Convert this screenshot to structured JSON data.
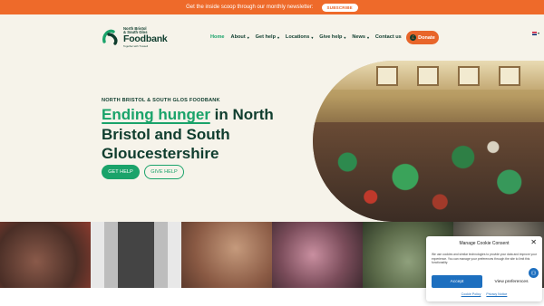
{
  "topbar": {
    "text": "Get the inside scoop through our monthly newsletter:",
    "button": "SUBSCRIBE"
  },
  "logo": {
    "line1": "North Bristol",
    "line2": "& South Glos",
    "name": "Foodbank",
    "tagline": "Together with Trussell"
  },
  "nav": {
    "items": [
      {
        "label": "Home",
        "active": true,
        "dropdown": false
      },
      {
        "label": "About",
        "dropdown": true
      },
      {
        "label": "Get help",
        "dropdown": true
      },
      {
        "label": "Locations",
        "dropdown": true
      },
      {
        "label": "Give help",
        "dropdown": true
      },
      {
        "label": "News",
        "dropdown": true
      },
      {
        "label": "Contact us",
        "dropdown": false
      }
    ],
    "donate": "Donate",
    "caret_glyph": "▾",
    "donate_icon_glyph": "£"
  },
  "hero": {
    "eyebrow": "NORTH BRISTOL & SOUTH GLOS FOODBANK",
    "headline_highlight": "Ending hunger",
    "headline_rest": " in North Bristol and South Gloucestershire",
    "btn_get_help": "GET HELP",
    "btn_give_help": "GIVE HELP"
  },
  "cookie": {
    "title": "Manage Cookie Consent",
    "close": "✕",
    "text": "We use cookies and similar technologies to provide your data and improve your experience. You can manage your preferences through the site to limit this functionality.",
    "accept": "Accept",
    "preferences": "View preferences",
    "link_cookie": "Cookie Policy",
    "link_privacy": "Privacy Notice"
  },
  "a11y_glyph": "⚇",
  "colors": {
    "orange": "#ee6a2a",
    "green": "#1aa36a",
    "dark_green": "#0f3d2e",
    "cream": "#f6f3ea",
    "blue": "#1d6fbf"
  }
}
